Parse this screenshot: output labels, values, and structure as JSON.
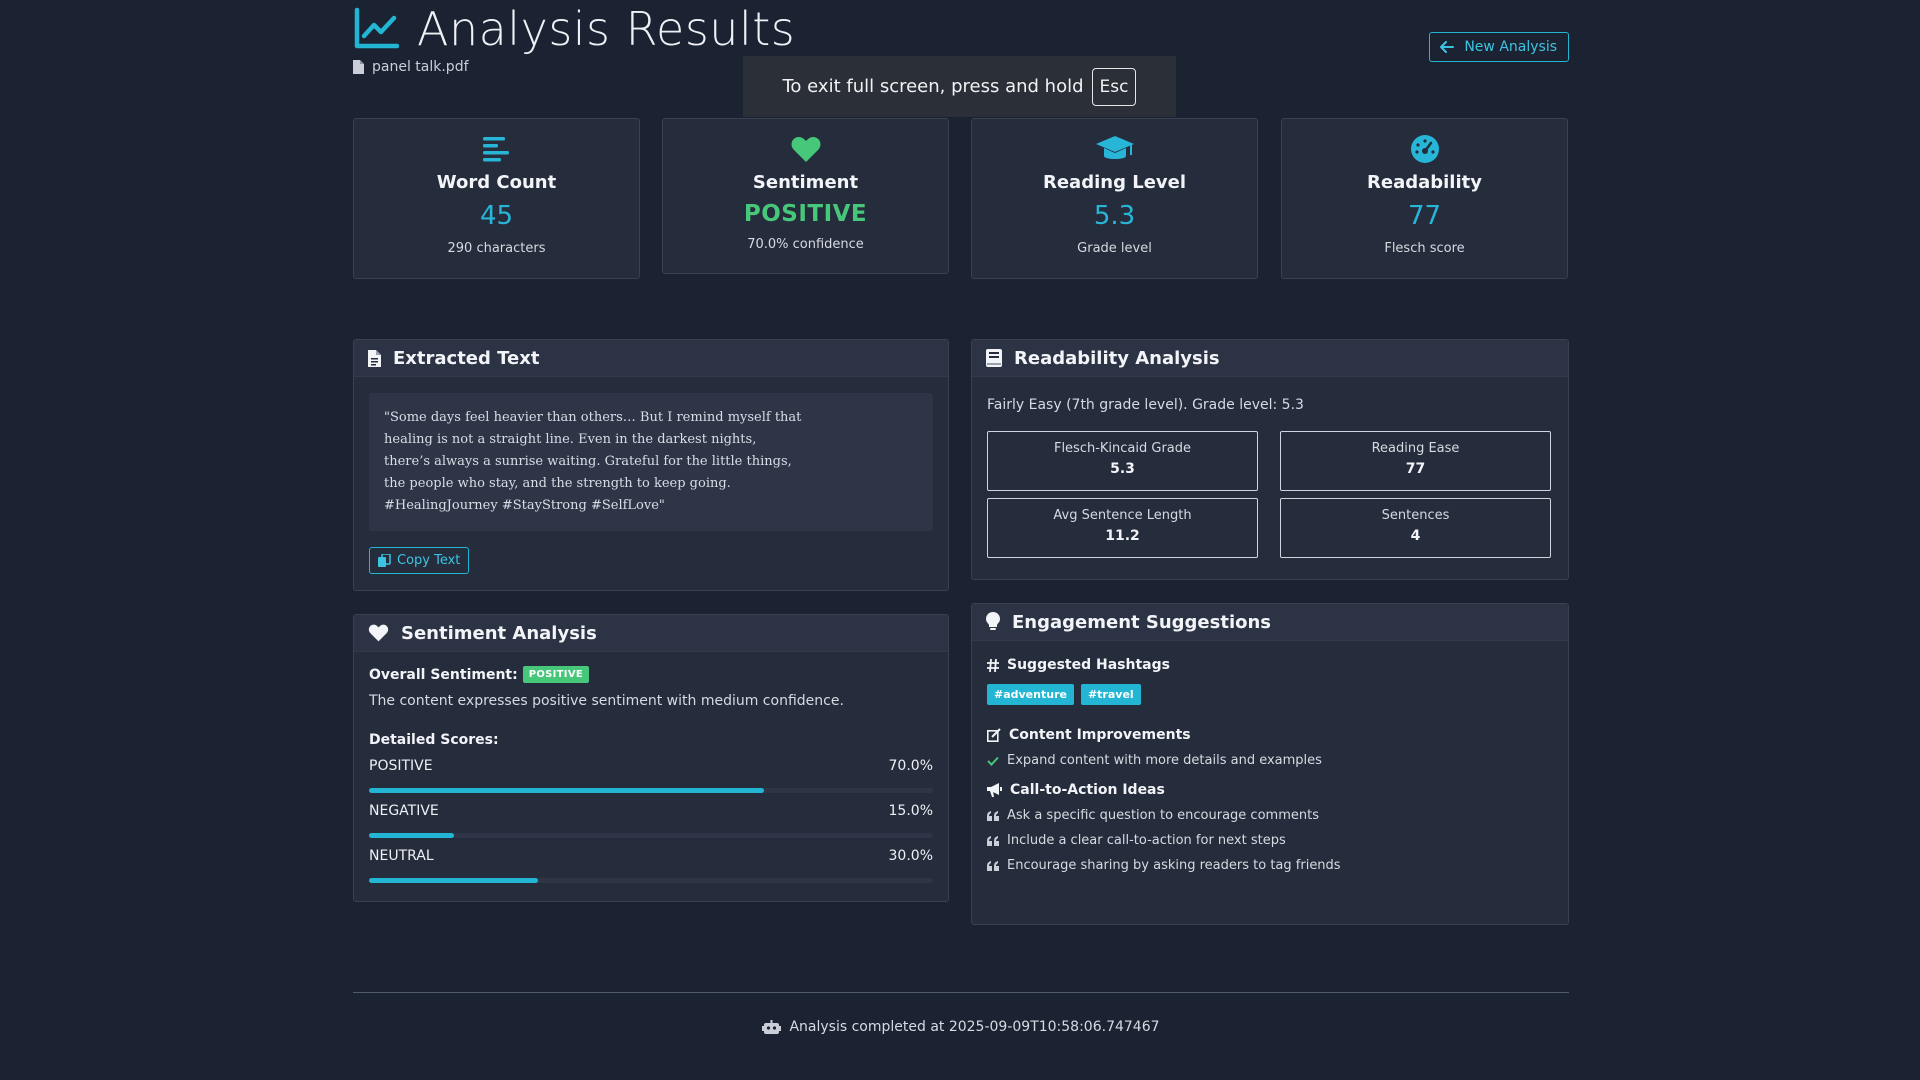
{
  "header": {
    "title": "Analysis Results",
    "file_name": "panel talk.pdf",
    "new_analysis_label": "New Analysis"
  },
  "fullscreen_toast": {
    "text": "To exit full screen, press and hold",
    "key": "Esc"
  },
  "stats": [
    {
      "label": "Word Count",
      "value": "45",
      "sub": "290 characters",
      "icon": "align-left-icon"
    },
    {
      "label": "Sentiment",
      "value": "POSITIVE",
      "sub": "70.0% confidence",
      "icon": "heart-icon"
    },
    {
      "label": "Reading Level",
      "value": "5.3",
      "sub": "Grade level",
      "icon": "graduation-cap-icon"
    },
    {
      "label": "Readability",
      "value": "77",
      "sub": "Flesch score",
      "icon": "gauge-icon"
    }
  ],
  "extracted": {
    "title": "Extracted Text",
    "lines": [
      "\"Some days feel heavier than others… But I remind myself that",
      "healing is not a straight line. Even in the darkest nights,",
      "there’s always a sunrise waiting. Grateful for the little things,",
      "the people who stay, and the strength to keep going.",
      "#HealingJourney #StayStrong #SelfLove\""
    ],
    "copy_label": "Copy Text"
  },
  "readability": {
    "title": "Readability Analysis",
    "description": "Fairly Easy (7th grade level). Grade level: 5.3",
    "metrics": [
      {
        "label": "Flesch-Kincaid Grade",
        "value": "5.3"
      },
      {
        "label": "Reading Ease",
        "value": "77"
      },
      {
        "label": "Avg Sentence Length",
        "value": "11.2"
      },
      {
        "label": "Sentences",
        "value": "4"
      }
    ]
  },
  "sentiment": {
    "title": "Sentiment Analysis",
    "overall_label": "Overall Sentiment:",
    "overall_value": "POSITIVE",
    "description": "The content expresses positive sentiment with medium confidence.",
    "detailed_label": "Detailed Scores:",
    "scores": [
      {
        "name": "POSITIVE",
        "text": "70.0%",
        "fraction": 0.7
      },
      {
        "name": "NEGATIVE",
        "text": "15.0%",
        "fraction": 0.15
      },
      {
        "name": "NEUTRAL",
        "text": "30.0%",
        "fraction": 0.3
      }
    ]
  },
  "engagement": {
    "title": "Engagement Suggestions",
    "hashtags_label": "Suggested Hashtags",
    "hashtags": [
      "#adventure",
      "#travel"
    ],
    "improvements_label": "Content Improvements",
    "improvements": [
      "Expand content with more details and examples"
    ],
    "cta_label": "Call-to-Action Ideas",
    "cta": [
      "Ask a specific question to encourage comments",
      "Include a clear call-to-action for next steps",
      "Encourage sharing by asking readers to tag friends"
    ]
  },
  "footer": {
    "text": "Analysis completed at 2025-09-09T10:58:06.747467"
  },
  "colors": {
    "accent": "#22b5d4",
    "positive": "#46c77a",
    "background": "#1b2231",
    "card": "#252c3b"
  }
}
